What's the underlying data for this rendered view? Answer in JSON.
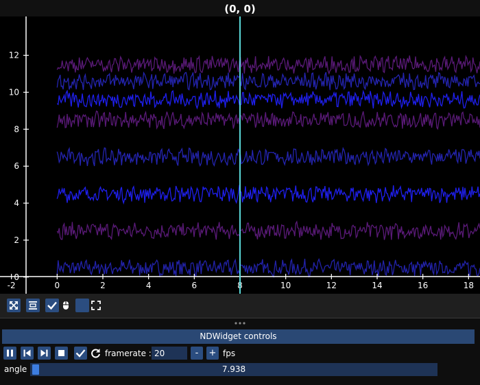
{
  "plot": {
    "title": "(0, 0)",
    "cursor_x": 8
  },
  "chart_data": {
    "type": "line",
    "title": "(0, 0)",
    "xlabel": "",
    "ylabel": "",
    "xlim": [
      -2.5,
      18.5
    ],
    "ylim": [
      -0.9,
      14.1
    ],
    "x_ticks": [
      -2,
      0,
      2,
      4,
      6,
      8,
      10,
      12,
      14,
      16,
      18
    ],
    "y_ticks": [
      0,
      2,
      4,
      6,
      8,
      10,
      12
    ],
    "x_range": [
      0,
      18.5
    ],
    "grid": false,
    "series": [
      {
        "offset": 0.5,
        "color": "#2222aa"
      },
      {
        "offset": 2.5,
        "color": "#5a1a78"
      },
      {
        "offset": 4.5,
        "color": "#1f1fee"
      },
      {
        "offset": 6.5,
        "color": "#2424b0"
      },
      {
        "offset": 8.5,
        "color": "#5a1a78"
      },
      {
        "offset": 9.6,
        "color": "#1f1fee"
      },
      {
        "offset": 10.6,
        "color": "#2424b0"
      },
      {
        "offset": 11.5,
        "color": "#5a1a78"
      }
    ],
    "cursor": {
      "x": 8,
      "color": "#5ad8d8"
    }
  },
  "toolbar": {
    "buttons": [
      "autoscale",
      "center",
      "maintain-aspect",
      "mouse-toggle",
      "blank",
      "fullscreen"
    ]
  },
  "controls": {
    "header": "NDWidget controls",
    "framerate_label": "framerate :",
    "framerate_value": "20",
    "minus_label": "-",
    "plus_label": "+",
    "fps_label": "fps",
    "angle_label": "angle",
    "angle_value": "7.938"
  }
}
